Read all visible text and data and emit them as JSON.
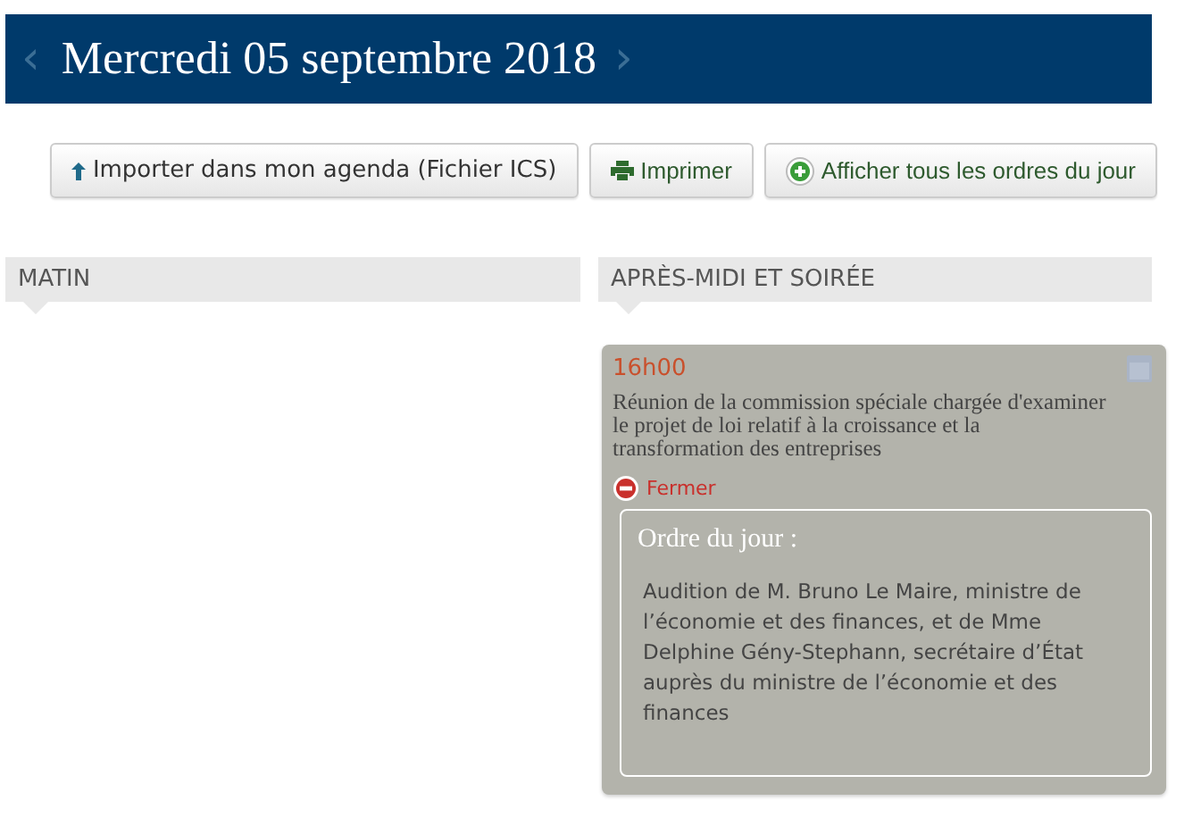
{
  "header": {
    "prev": "‹",
    "title": "Mercredi 05 septembre 2018",
    "next": "›"
  },
  "toolbar": [
    {
      "kind": "upload",
      "label": "Importer dans mon agenda (Fichier ICS)"
    },
    {
      "kind": "print",
      "label": "Imprimer"
    },
    {
      "kind": "expand",
      "label": "Afficher tous les ordres du jour"
    }
  ],
  "columns": [
    {
      "heading": "MATIN"
    },
    {
      "heading": "APRÈS-MIDI ET SOIRÉE",
      "events": [
        {
          "time": "16h00",
          "title": "Réunion de la commission spéciale chargée d'examiner le projet de loi relatif à la croissance et la transformation des entreprises",
          "toggle": "Fermer",
          "expanded": true,
          "agenda_title": "Ordre du jour :",
          "agenda": "Audition de M. Bruno Le Maire, ministre de l’économie et des finances, et de Mme Delphine Gény-Stephann, secrétaire d’État auprès du ministre de l’économie et des finances"
        }
      ]
    }
  ]
}
